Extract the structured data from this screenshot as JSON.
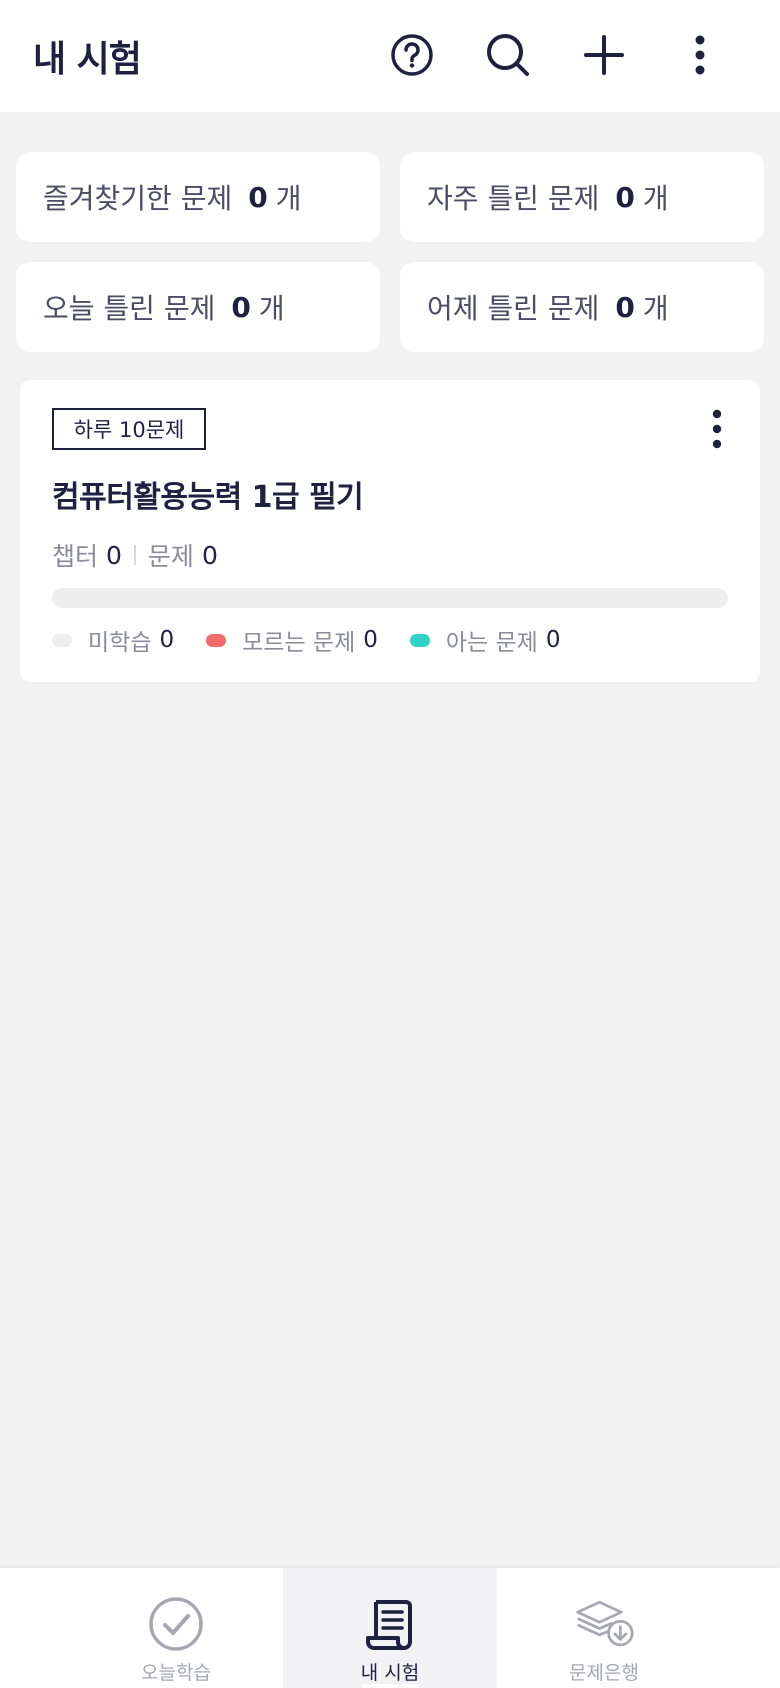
{
  "header": {
    "title": "내 시험",
    "icons": [
      "help-icon",
      "search-icon",
      "plus-icon",
      "more-vertical-icon"
    ]
  },
  "stats": [
    {
      "label": "즐겨찾기한 문제",
      "count": "0",
      "unit": "개"
    },
    {
      "label": "자주 틀린 문제",
      "count": "0",
      "unit": "개"
    },
    {
      "label": "오늘 틀린 문제",
      "count": "0",
      "unit": "개"
    },
    {
      "label": "어제 틀린 문제",
      "count": "0",
      "unit": "개"
    }
  ],
  "exam": {
    "badge": "하루 10문제",
    "name": "컴퓨터활용능력 1급 필기",
    "chapter_label": "챕터",
    "chapter_count": "0",
    "question_label": "문제",
    "question_count": "0",
    "progress": 0,
    "legend": [
      {
        "label": "미학습",
        "count": "0",
        "color": "#eeeeee"
      },
      {
        "label": "모르는 문제",
        "count": "0",
        "color": "#f36b6b"
      },
      {
        "label": "아는 문제",
        "count": "0",
        "color": "#2ed3c6"
      }
    ]
  },
  "nav": {
    "items": [
      {
        "label": "오늘학습",
        "icon": "check-circle-icon",
        "active": false
      },
      {
        "label": "내 시험",
        "icon": "scroll-icon",
        "active": true
      },
      {
        "label": "문제은행",
        "icon": "layers-download-icon",
        "active": false
      }
    ]
  }
}
